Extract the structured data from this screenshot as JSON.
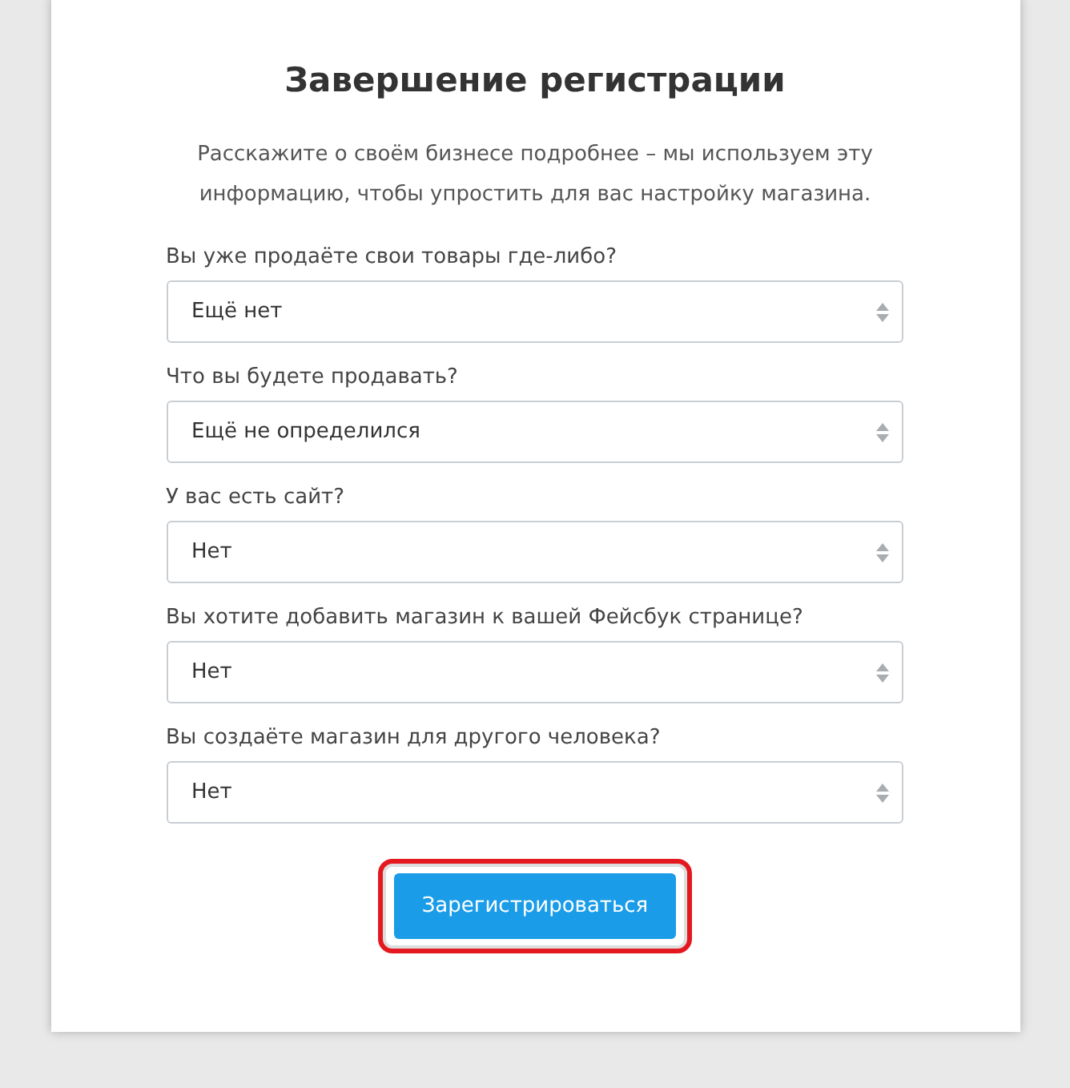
{
  "title": "Завершение регистрации",
  "description": "Расскажите о своём бизнесе подробнее – мы используем эту информацию, чтобы упростить для вас настройку магазина.",
  "questions": [
    {
      "label": "Вы уже продаёте свои товары где-либо?",
      "value": "Ещё нет"
    },
    {
      "label": "Что вы будете продавать?",
      "value": "Ещё не определился"
    },
    {
      "label": "У вас есть сайт?",
      "value": "Нет"
    },
    {
      "label": "Вы хотите добавить магазин к вашей Фейсбук странице?",
      "value": "Нет"
    },
    {
      "label": "Вы создаёте магазин для другого человека?",
      "value": "Нет"
    }
  ],
  "submit": {
    "label": "Зарегистрироваться",
    "highlighted": true
  }
}
